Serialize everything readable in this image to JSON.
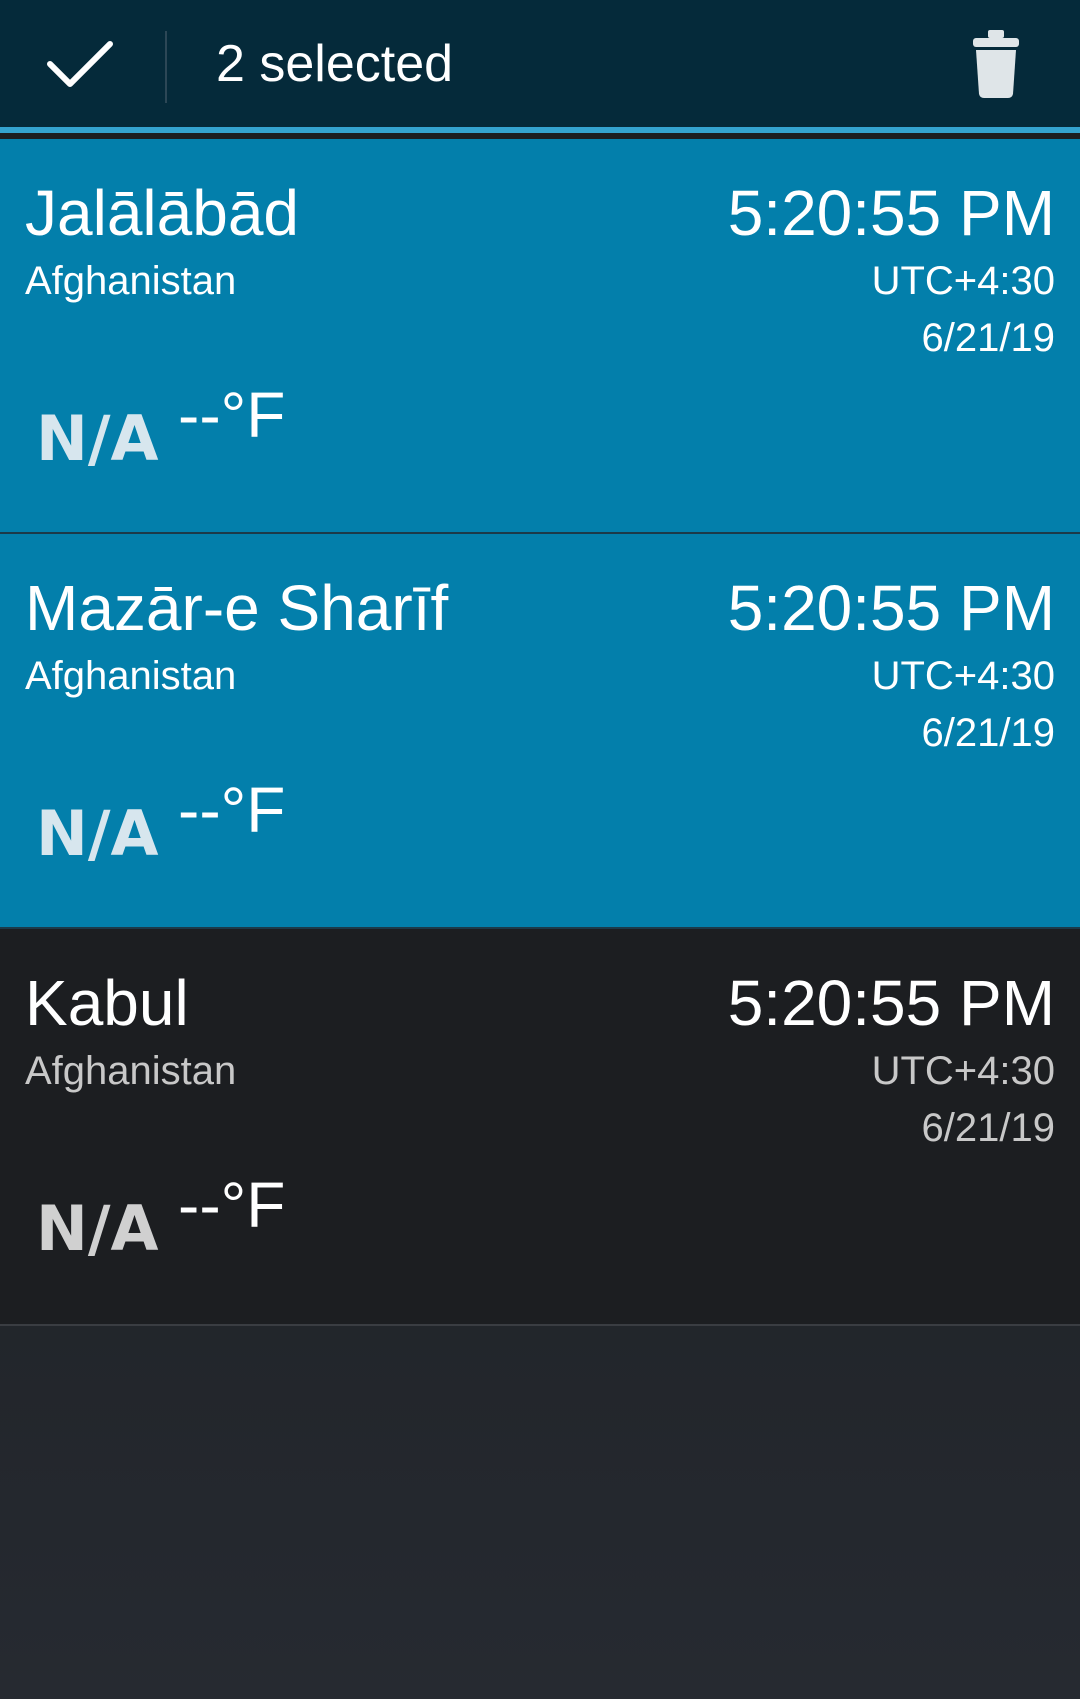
{
  "action_bar": {
    "done_icon": "checkmark-icon",
    "title": "2 selected",
    "delete_icon": "trash-icon",
    "background": "#052a3a",
    "accent": "#34a3cf"
  },
  "clocks": [
    {
      "city": "Jalālābād",
      "country": "Afghanistan",
      "time": "5:20:55 PM",
      "utc_offset": "UTC+4:30",
      "date": "6/21/19",
      "weather": "N/A",
      "temperature": "--°F",
      "selected": true
    },
    {
      "city": "Mazār-e Sharīf",
      "country": "Afghanistan",
      "time": "5:20:55 PM",
      "utc_offset": "UTC+4:30",
      "date": "6/21/19",
      "weather": "N/A",
      "temperature": "--°F",
      "selected": true
    },
    {
      "city": "Kabul",
      "country": "Afghanistan",
      "time": "5:20:55 PM",
      "utc_offset": "UTC+4:30",
      "date": "6/21/19",
      "weather": "N/A",
      "temperature": "--°F",
      "selected": false
    }
  ],
  "colors": {
    "selected_row": "#037fab",
    "plain_row": "#1c1e21"
  }
}
